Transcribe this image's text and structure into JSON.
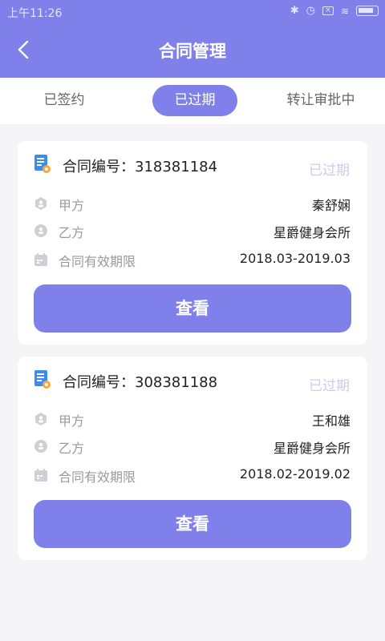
{
  "status_bar": {
    "time": "上午11:26"
  },
  "header": {
    "title": "合同管理",
    "accent_color": "#7f80ea"
  },
  "tabs": [
    {
      "label": "已签约"
    },
    {
      "label": "已过期"
    },
    {
      "label": "转让审批中"
    }
  ],
  "active_tab": "已过期",
  "contracts": [
    {
      "number_text": "合同编号：318381184",
      "status": "已过期",
      "party_a_label": "甲方",
      "party_a": "秦舒娴",
      "party_b_label": "乙方",
      "party_b": "星爵健身会所",
      "period_label": "合同有效期限",
      "period": "2018.03-2019.03",
      "button_label": "查看"
    },
    {
      "number_text": "合同编号：308381188",
      "status": "已过期",
      "party_a_label": "甲方",
      "party_a": "王和雄",
      "party_b_label": "乙方",
      "party_b": "星爵健身会所",
      "period_label": "合同有效期限",
      "period": "2018.02-2019.02",
      "button_label": "查看"
    }
  ]
}
